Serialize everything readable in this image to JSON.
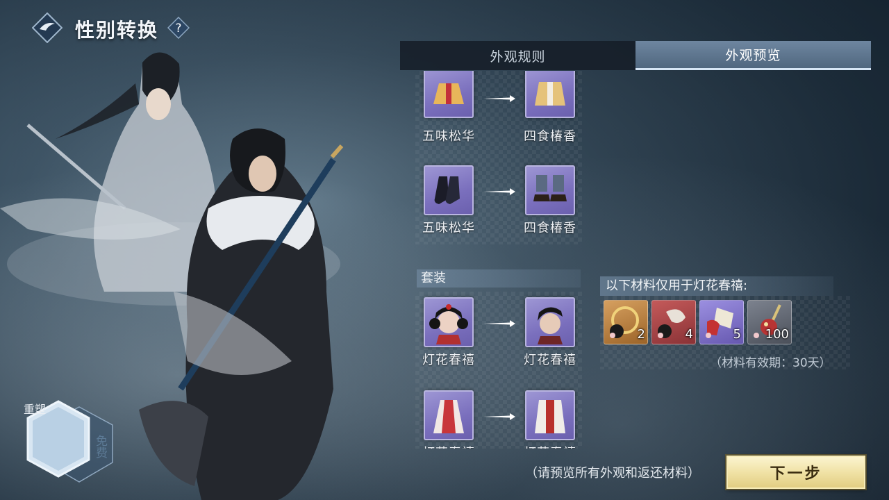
{
  "header": {
    "title": "性别转换",
    "help_symbol": "?"
  },
  "tabs": [
    {
      "label": "外观规则",
      "active": false
    },
    {
      "label": "外观预览",
      "active": true
    }
  ],
  "outfit_pairs": [
    {
      "from": "五味松华",
      "to": "四食椿香",
      "slot": "top"
    },
    {
      "from": "五味松华",
      "to": "四食椿香",
      "slot": "shoes"
    }
  ],
  "set_section": {
    "title": "套装",
    "pairs": [
      {
        "from": "灯花春禧",
        "to": "灯花春禧",
        "slot": "head"
      },
      {
        "from": "灯花春禧",
        "to": "灯花春禧",
        "slot": "outfit"
      }
    ]
  },
  "materials": {
    "title": "以下材料仅用于灯花春禧:",
    "items": [
      {
        "icon": "gold-ring-material-icon",
        "count": "2",
        "bg": "#b07a3a"
      },
      {
        "icon": "red-ribbon-material-icon",
        "count": "4",
        "bg": "#a04548"
      },
      {
        "icon": "scroll-material-icon",
        "count": "5",
        "bg": "#7d72c4"
      },
      {
        "icon": "firework-material-icon",
        "count": "100",
        "bg": "#5e6470"
      }
    ],
    "validity": "（材料有效期：30天）"
  },
  "badge": {
    "main": "重塑",
    "side": "免费"
  },
  "footer": {
    "hint": "（请预览所有外观和返还材料）",
    "next_label": "下一步"
  },
  "colors": {
    "tab_active": "#5f7790",
    "item_bg": "#8a82c8",
    "next_button": "#f0e1a5"
  }
}
